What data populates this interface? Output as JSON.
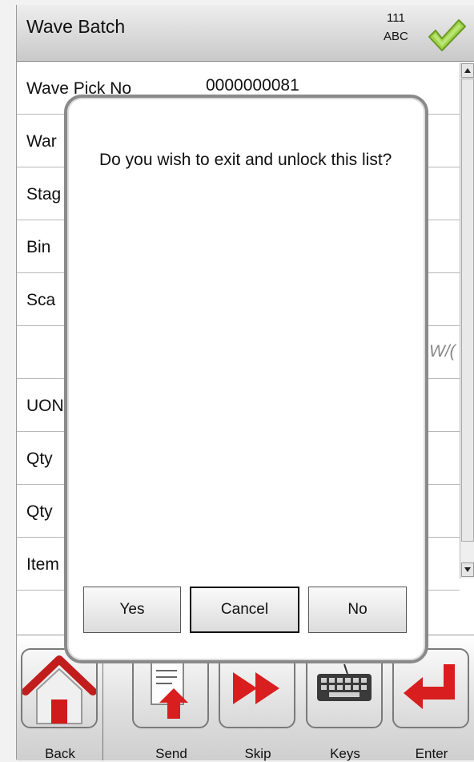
{
  "header": {
    "title": "Wave Batch",
    "mode_number": "111",
    "mode_letters": "ABC"
  },
  "form": {
    "rows": [
      {
        "label": "Wave Pick No",
        "value": "0000000081"
      },
      {
        "label": "War",
        "value": ""
      },
      {
        "label": "Stag",
        "value": ""
      },
      {
        "label": "Bin",
        "value": ""
      },
      {
        "label": "Sca",
        "value": ""
      },
      {
        "label": "",
        "value": "W/("
      },
      {
        "label": "UON",
        "value": ""
      },
      {
        "label": "Qty",
        "value": ""
      },
      {
        "label": "Qty",
        "value": ""
      },
      {
        "label": "Item",
        "value": ""
      }
    ]
  },
  "dialog": {
    "message": "Do you wish to exit and unlock this list?",
    "yes_label": "Yes",
    "cancel_label": "Cancel",
    "no_label": "No"
  },
  "toolbar": {
    "back_label": "Back",
    "send_label": "Send",
    "skip_label": "Skip",
    "keys_label": "Keys",
    "enter_label": "Enter"
  },
  "colors": {
    "accent_green": "#8cc63f",
    "accent_red": "#d81e1e",
    "dialog_border": "#8a8a8a"
  },
  "icons": [
    "check-icon",
    "home-icon",
    "send-icon",
    "fast-forward-icon",
    "keyboard-icon",
    "enter-arrow-icon",
    "scroll-up-icon",
    "scroll-down-icon"
  ]
}
